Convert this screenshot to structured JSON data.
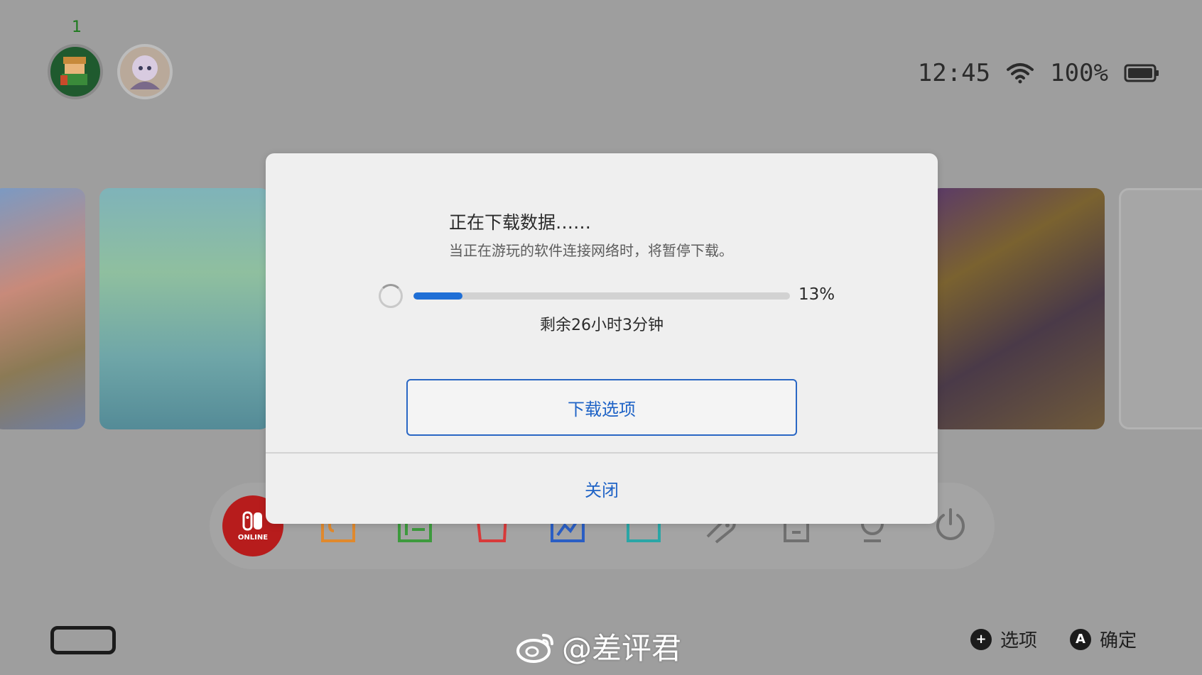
{
  "topbar": {
    "user_count": "1",
    "time": "12:45",
    "battery_percent": "100%"
  },
  "dialog": {
    "title": "正在下载数据……",
    "subtitle": "当正在游玩的软件连接网络时，将暂停下载。",
    "progress_value": 13,
    "progress_text": "13%",
    "remaining_text": "剩余26小时3分钟",
    "options_button_label": "下载选项",
    "close_button_label": "关闭"
  },
  "dock": {
    "online_label": "ONLINE"
  },
  "footer": {
    "watermark": "@差评君",
    "options_hint_icon": "+",
    "options_hint_label": "选项",
    "confirm_hint_icon": "A",
    "confirm_hint_label": "确定"
  },
  "colors": {
    "background": "#9e9e9e",
    "accent_blue": "#1f63c6",
    "progress_fill": "#1f6fd6",
    "online_red": "#b71c1c"
  },
  "icons": [
    "user-avatar",
    "wifi-icon",
    "battery-icon",
    "spinner-icon",
    "news-icon",
    "shop-icon",
    "album-icon",
    "controllers-icon",
    "settings-icon",
    "power-icon",
    "console-icon",
    "weibo-icon",
    "plus-icon",
    "a-button-icon"
  ]
}
